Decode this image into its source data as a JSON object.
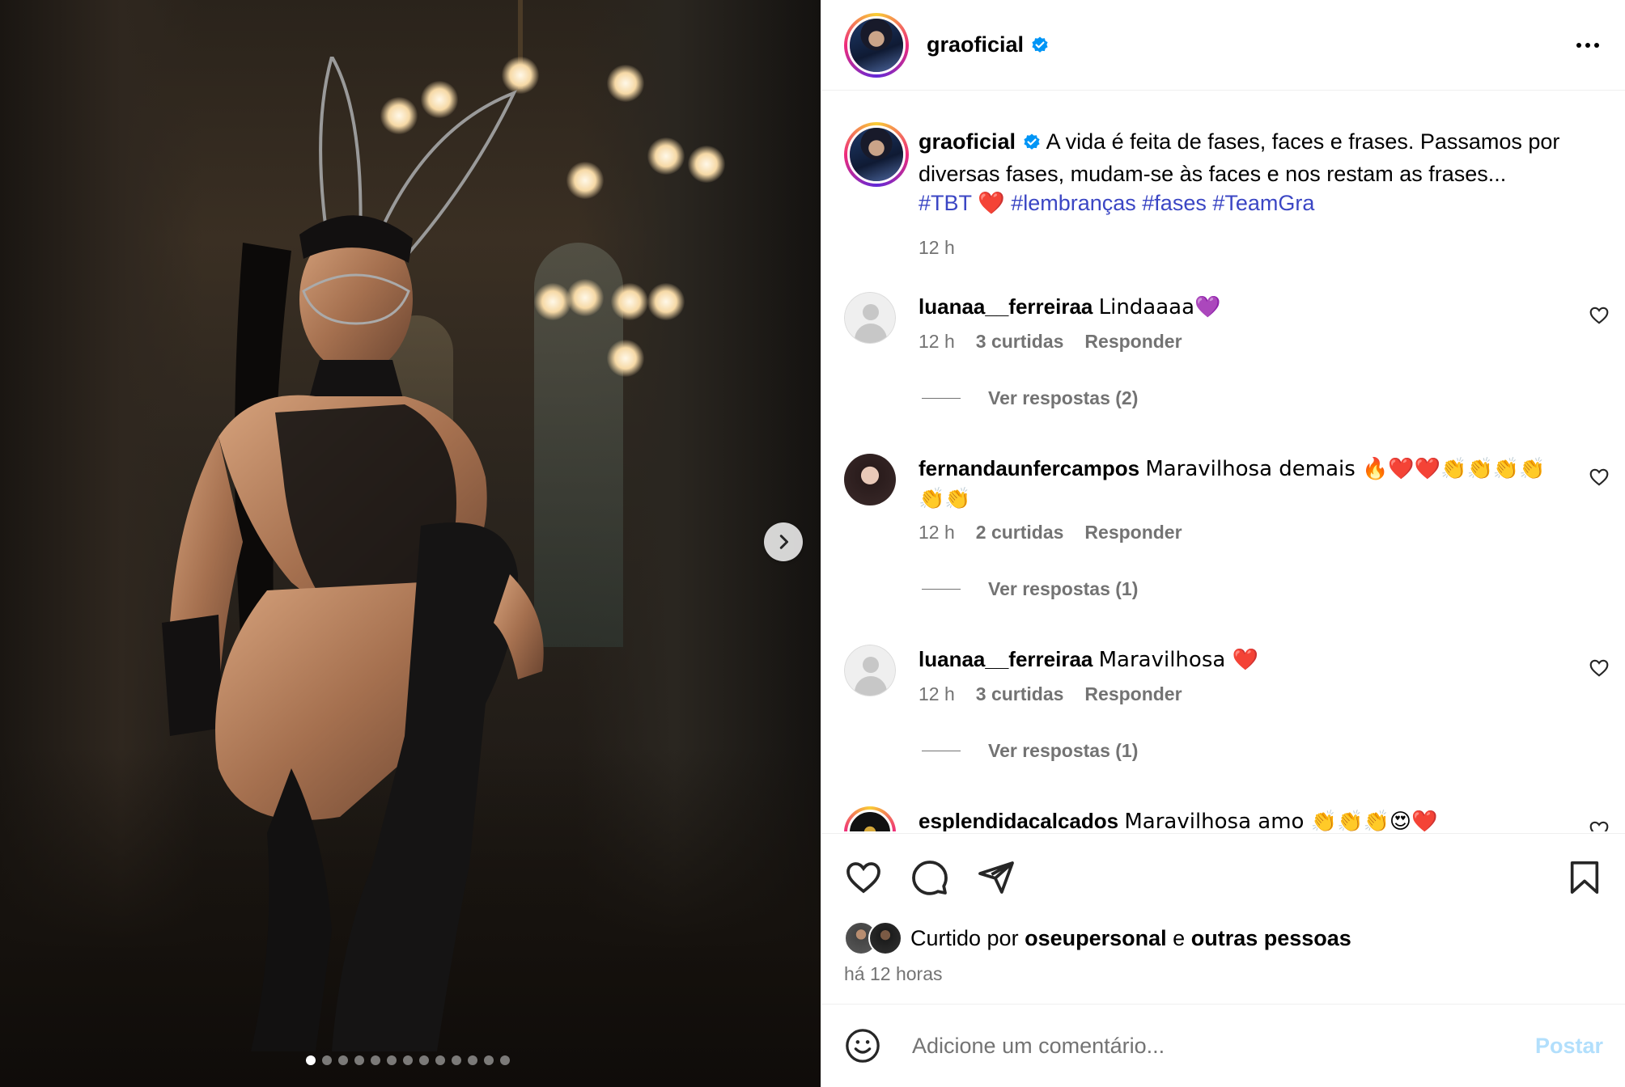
{
  "post": {
    "author": "graoficial",
    "verified": true,
    "caption": "A vida é feita de fases, faces e frases. Passamos por diversas fases, mudam-se às faces e nos restam as frases...",
    "hashtags": [
      "#TBT",
      "#lembranças",
      "#fases",
      "#TeamGra"
    ],
    "heart_emoji": "❤️",
    "caption_time": "12 h",
    "carousel": {
      "total_slides": 13,
      "active_slide": 1
    }
  },
  "comments": [
    {
      "user": "luanaa__ferreiraa",
      "text": "Lindaaaa💜",
      "time": "12 h",
      "likes": "3 curtidas",
      "reply": "Responder",
      "view_replies": "Ver respostas (2)"
    },
    {
      "user": "fernandaunfercampos",
      "text": "Maravilhosa demais 🔥❤️❤️👏👏👏👏👏👏",
      "time": "12 h",
      "likes": "2 curtidas",
      "reply": "Responder",
      "view_replies": "Ver respostas (1)"
    },
    {
      "user": "luanaa__ferreiraa",
      "text": "Maravilhosa ❤️",
      "time": "12 h",
      "likes": "3 curtidas",
      "reply": "Responder",
      "view_replies": "Ver respostas (1)"
    },
    {
      "user": "esplendidacalcados",
      "text": "Maravilhosa amo 👏👏👏😍❤️"
    }
  ],
  "likes": {
    "prefix": "Curtido por",
    "user": "oseupersonal",
    "and": "e",
    "others": "outras pessoas"
  },
  "time_ago": "há 12 horas",
  "comment_input": {
    "placeholder": "Adicione um comentário...",
    "post_label": "Postar"
  },
  "icons": {
    "more": "more-options-icon",
    "like": "heart-icon",
    "comment": "comment-icon",
    "share": "share-icon",
    "save": "bookmark-icon",
    "emoji": "emoji-icon",
    "next": "chevron-right-icon"
  },
  "colors": {
    "link": "#3b46c4",
    "secondary": "#737373",
    "post_disabled": "#b2dffc",
    "verified": "#0095f6"
  }
}
